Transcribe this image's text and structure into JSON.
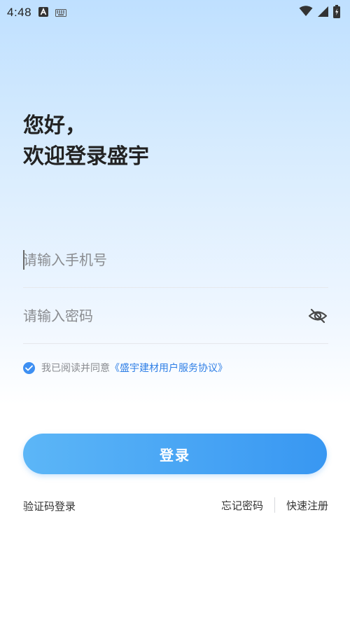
{
  "status_bar": {
    "time": "4:48"
  },
  "greeting": {
    "line1": "您好，",
    "line2": "欢迎登录盛宇"
  },
  "phone_field": {
    "placeholder": "请输入手机号",
    "value": ""
  },
  "password_field": {
    "placeholder": "请输入密码",
    "value": ""
  },
  "agreement": {
    "checked": true,
    "prefix": "我已阅读并同意",
    "link": "《盛宇建材用户服务协议》"
  },
  "login_button": {
    "label": "登录"
  },
  "bottom_links": {
    "sms_login": "验证码登录",
    "forgot_password": "忘记密码",
    "quick_register": "快速注册"
  },
  "colors": {
    "accent": "#3d8ff2",
    "link": "#2f7fe6",
    "button_start": "#5cb6f7",
    "button_end": "#3897f2"
  },
  "icons": {
    "status_left": [
      "app-a-icon",
      "keyboard-icon"
    ],
    "status_right": [
      "wifi-icon",
      "cellular-signal-icon",
      "battery-charging-icon"
    ],
    "password_toggle": "eye-off-icon",
    "agreement_check": "check-circle-icon"
  }
}
